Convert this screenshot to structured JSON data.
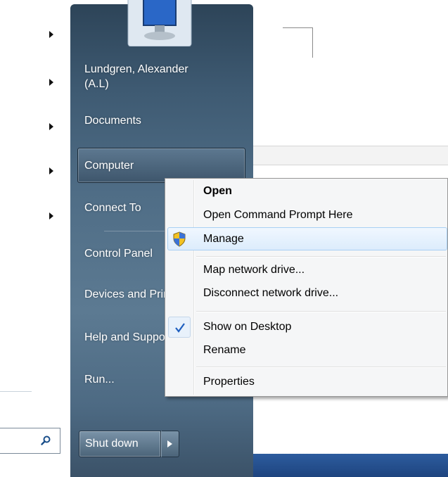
{
  "start_menu": {
    "left_pane": {
      "search_placeholder": ""
    },
    "right_pane": {
      "user_name": "Lundgren, Alexander",
      "user_initials": "(A.L)",
      "items": [
        {
          "label": "Documents"
        },
        {
          "label": "Computer"
        },
        {
          "label": "Connect To"
        },
        {
          "label": "Control Panel"
        },
        {
          "label": "Devices and Printers"
        },
        {
          "label": "Help and Support"
        },
        {
          "label": "Run..."
        }
      ],
      "shutdown_label": "Shut down"
    }
  },
  "context_menu": {
    "items": [
      {
        "label": "Open"
      },
      {
        "label": "Open Command Prompt Here"
      },
      {
        "label": "Manage"
      },
      {
        "label": "Map network drive..."
      },
      {
        "label": "Disconnect network drive..."
      },
      {
        "label": "Show on Desktop"
      },
      {
        "label": "Rename"
      },
      {
        "label": "Properties"
      }
    ]
  },
  "colors": {
    "hover_border": "#a8d0f4",
    "check_color": "#1f5fbf",
    "taskbar": "#2d5c9e"
  },
  "icons": {
    "manage_icon": "uac-shield-icon",
    "check_icon": "checkmark-icon",
    "search_icon": "search-icon"
  }
}
